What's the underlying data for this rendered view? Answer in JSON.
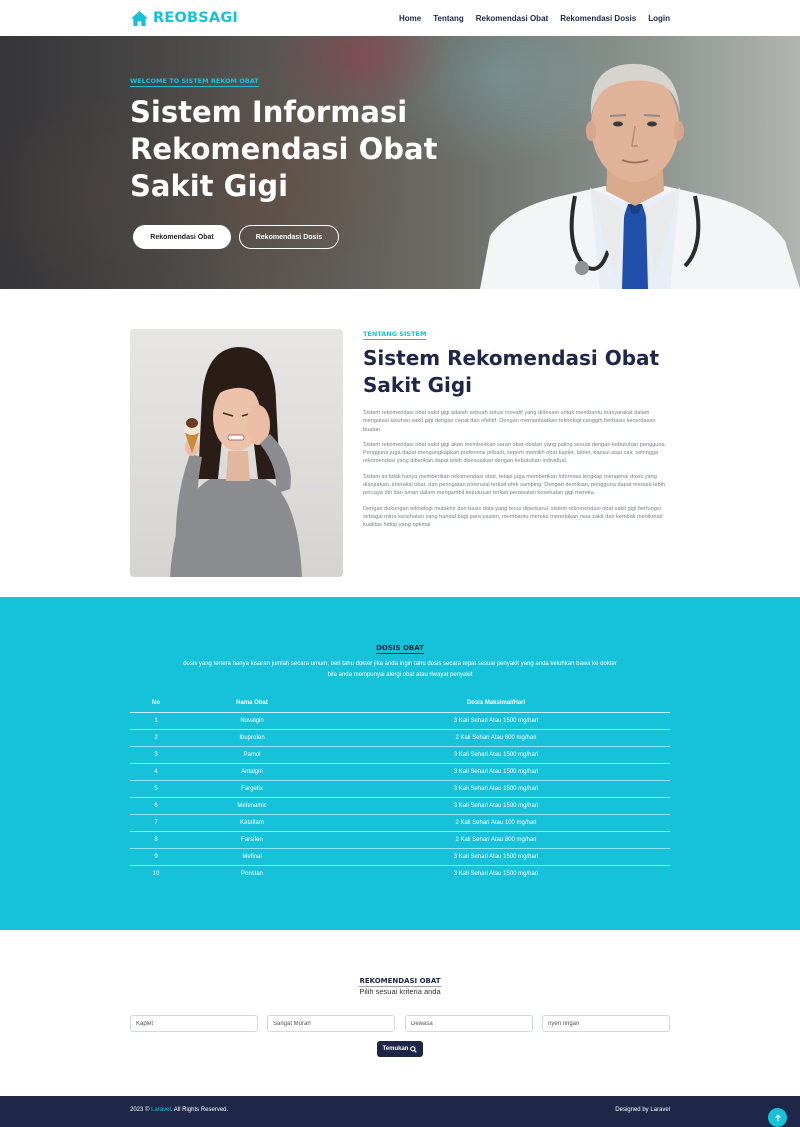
{
  "nav": {
    "brand": "REOBSAGI",
    "items": [
      "Home",
      "Tentang",
      "Rekomendasi Obat",
      "Rekomendasi Dosis",
      "Login"
    ]
  },
  "hero": {
    "eyebrow": "WELCOME TO SISTEM REKOM OBAT",
    "title": "Sistem Informasi Rekomendasi Obat Sakit Gigi",
    "btn_primary": "Rekomendasi Obat",
    "btn_secondary": "Rekomendasi Dosis"
  },
  "about": {
    "label": "TENTANG SISTEM",
    "title": "Sistem Rekomendasi Obat Sakit Gigi",
    "paragraphs": [
      "Sistem rekomendasi obat sakit gigi adalah sebuah solusi inovatif yang didesain untuk membantu masyarakat dalam mengatasi keluhan sakit gigi dengan cepat dan efektif. Dengan memanfaatkan teknologi canggih berbasis kecerdasan buatan.",
      "Sistem rekomendasi obat sakit gigi akan memberikan saran obat-obatan yang paling sesuai dengan kebutuhan pengguna. Pengguna juga dapat mengungkapkan preferensi pribadi, seperti memilih obat kaplet, tablet, kapsul atau cair, sehingga rekomendasi yang diberikan dapat lebih disesuaikan dengan kebutuhan individual.",
      "Sistem ini tidak hanya memberikan rekomendasi obat, tetapi juga memberikan informasi lengkap mengenai dosis yang dianjurkan, interaksi obat, dan peringatan potensial terkait efek samping. Dengan demikian, pengguna dapat merasa lebih percaya diri dan aman dalam mengambil keputusan terkait perawatan kesehatan gigi mereka.",
      "Dengan dukungan teknologi mutakhir dan basis data yang terus diperbarui, sistem rekomendasi obat sakit gigi berfungsi sebagai mitra kesehatan yang handal bagi para pasien, membantu mereka meredakan rasa sakit dan kembali menikmati kualitas hidup yang optimal"
    ]
  },
  "dosis": {
    "title": "DOSIS OBAT",
    "description": "dosis yang tertera hanya kisaran jumlah secara umum, beri tahu dokter jika anda ingin tahu dosis secara tepat sesuai penyakit yang anda keluhkan bawa ke dokter bila anda mempunyai alergi obat atau riwayat penyakit",
    "headers": [
      "No",
      "Nama Obat",
      "Dosis Maksimal/Hari"
    ],
    "rows": [
      [
        "1",
        "Novalgin",
        "3 Kali Sehari Atau 1500 mg/hari"
      ],
      [
        "2",
        "Ibuprofen",
        "2 Kali Sehari Atau 800 mg/hari"
      ],
      [
        "3",
        "Pamol",
        "3 Kali Sehari Atau 1500 mg/hari"
      ],
      [
        "4",
        "Antalgin",
        "3 Kali Sehari Atau 1500 mg/hari"
      ],
      [
        "5",
        "Fargetix",
        "3 Kali Sehari Atau 1500 mg/hari"
      ],
      [
        "6",
        "Mefenamic",
        "3 Kali Sehari Atau 1500 mg/hari"
      ],
      [
        "7",
        "Kataflam",
        "2 Kali Sehari Atau 100 mg/hari"
      ],
      [
        "8",
        "Farsifen",
        "2 Kali Sehari Atau 800 mg/hari"
      ],
      [
        "9",
        "Mefinal",
        "3 Kali Sehari Atau 1500 mg/hari"
      ],
      [
        "10",
        "Ponstan",
        "3 Kali Sehari Atau 1500 mg/hari"
      ]
    ]
  },
  "rekomendasi": {
    "title": "REKOMENDASI OBAT",
    "subtitle": "Pilih sesuai kriteria anda",
    "inputs": [
      {
        "value": "Kaplet"
      },
      {
        "value": "Sangat Murah"
      },
      {
        "value": "Dewasa"
      },
      {
        "value": "nyeri ringan"
      }
    ],
    "button": "Temukan"
  },
  "footer": {
    "copyright_prefix": "2023 © ",
    "link": "Laravel",
    "copyright_suffix": ". All Rights Reserved.",
    "designed": "Designed by Laravel"
  },
  "colors": {
    "accent": "#16c1da",
    "navy": "#1e2747"
  },
  "icons": {
    "brand": "home-icon",
    "search": "search-icon",
    "back_to_top": "arrow-up-icon"
  }
}
